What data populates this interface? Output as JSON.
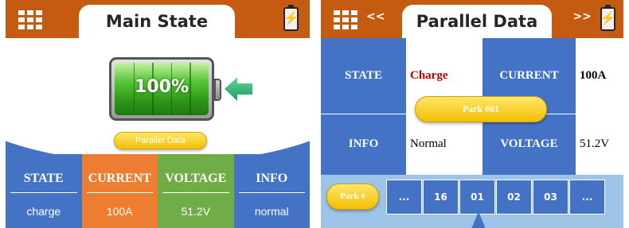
{
  "colors": {
    "header": "#c55a11",
    "blue": "#4472c4",
    "orange": "#ed7d31",
    "green": "#70ad47",
    "light_blue": "#9dc3e6",
    "yellow": "#ffc000",
    "charge_red": "#c00000"
  },
  "left_panel": {
    "title": "Main State",
    "menu_icon": "grid-menu-icon",
    "battery_icon": "battery-charging-icon",
    "battery_level": {
      "text": "100%",
      "fraction": 1.0
    },
    "arrow_icon": "left-arrow-icon",
    "parallel_button": "Parallel Data",
    "metrics": [
      {
        "label": "STATE",
        "value": "charge",
        "color": "#4472c4"
      },
      {
        "label": "CURRENT",
        "value": "100A",
        "color": "#ed7d31"
      },
      {
        "label": "VOLTAGE",
        "value": "51.2V",
        "color": "#70ad47"
      },
      {
        "label": "INFO",
        "value": "normal",
        "color": "#4472c4"
      }
    ]
  },
  "right_panel": {
    "title": "Parallel Data",
    "prev_label": "<<",
    "next_label": ">>",
    "menu_icon": "grid-menu-icon",
    "battery_icon": "battery-charging-icon",
    "state_label": "STATE",
    "state_value": "Charge",
    "current_label": "CURRENT",
    "current_value": "100A",
    "info_label": "INFO",
    "info_value": "Normal",
    "voltage_label": "VOLTAGE",
    "voltage_value": "51.2V",
    "park_popup": "Park #01",
    "park_label": "Park #",
    "park_items": [
      "...",
      "16",
      "01",
      "02",
      "03",
      "..."
    ]
  }
}
